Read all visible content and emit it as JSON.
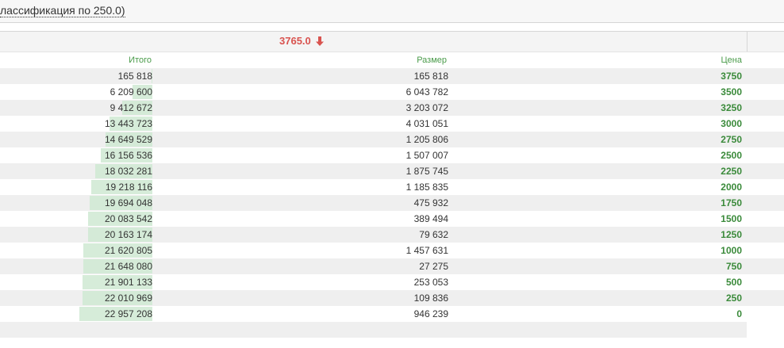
{
  "header": {
    "title": "лассификация по 250.0)"
  },
  "price_bar": {
    "last_price": "3765.0",
    "direction_icon": "arrow-down-icon",
    "direction_color": "#d9534f"
  },
  "table": {
    "columns": {
      "total": "Итого",
      "size": "Размер",
      "price": "Цена"
    },
    "accent_color": "#3a8a3a",
    "rows": [
      {
        "total": "165 818",
        "size": "165 818",
        "price": "3750",
        "depth": 0.0072
      },
      {
        "total": "6 209 600",
        "size": "6 043 782",
        "price": "3500",
        "depth": 0.27
      },
      {
        "total": "9 412 672",
        "size": "3 203 072",
        "price": "3250",
        "depth": 0.41
      },
      {
        "total": "13 443 723",
        "size": "4 031 051",
        "price": "3000",
        "depth": 0.586
      },
      {
        "total": "14 649 529",
        "size": "1 205 806",
        "price": "2750",
        "depth": 0.638
      },
      {
        "total": "16 156 536",
        "size": "1 507 007",
        "price": "2500",
        "depth": 0.704
      },
      {
        "total": "18 032 281",
        "size": "1 875 745",
        "price": "2250",
        "depth": 0.785
      },
      {
        "total": "19 218 116",
        "size": "1 185 835",
        "price": "2000",
        "depth": 0.837
      },
      {
        "total": "19 694 048",
        "size": "475 932",
        "price": "1750",
        "depth": 0.858
      },
      {
        "total": "20 083 542",
        "size": "389 494",
        "price": "1500",
        "depth": 0.875
      },
      {
        "total": "20 163 174",
        "size": "79 632",
        "price": "1250",
        "depth": 0.878
      },
      {
        "total": "21 620 805",
        "size": "1 457 631",
        "price": "1000",
        "depth": 0.942
      },
      {
        "total": "21 648 080",
        "size": "27 275",
        "price": "750",
        "depth": 0.943
      },
      {
        "total": "21 901 133",
        "size": "253 053",
        "price": "500",
        "depth": 0.954
      },
      {
        "total": "22 010 969",
        "size": "109 836",
        "price": "250",
        "depth": 0.959
      },
      {
        "total": "22 957 208",
        "size": "946 239",
        "price": "0",
        "depth": 1.0
      }
    ]
  }
}
